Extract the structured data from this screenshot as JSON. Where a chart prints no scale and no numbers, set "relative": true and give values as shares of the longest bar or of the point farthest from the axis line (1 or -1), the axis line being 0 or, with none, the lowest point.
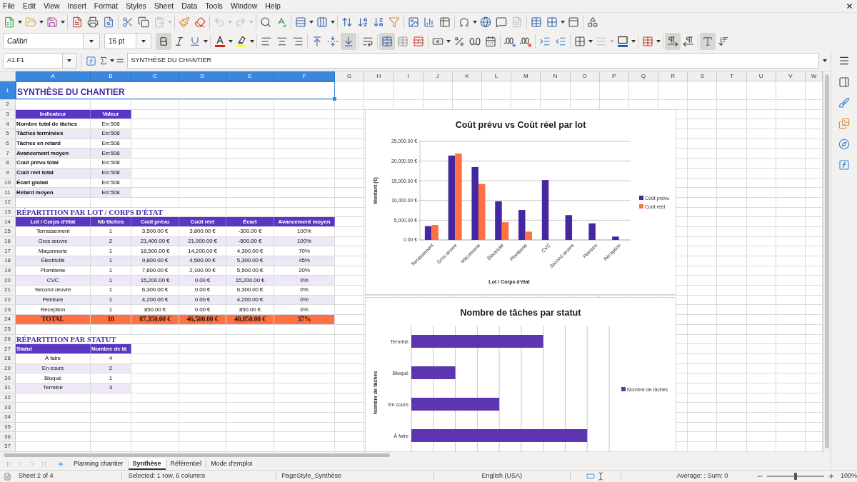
{
  "menu_bar": {
    "items": [
      "File",
      "Edit",
      "View",
      "Insert",
      "Format",
      "Styles",
      "Sheet",
      "Data",
      "Tools",
      "Window",
      "Help"
    ]
  },
  "standard_toolbar": {
    "groups": [
      [
        {
          "kind": "new",
          "dropdown": true,
          "disabled": false
        },
        {
          "kind": "open",
          "dropdown": true,
          "disabled": false
        },
        {
          "kind": "save",
          "dropdown": true,
          "disabled": false
        }
      ],
      [
        {
          "kind": "export_pdf",
          "dropdown": false,
          "disabled": false
        },
        {
          "kind": "print",
          "dropdown": false,
          "disabled": false
        },
        {
          "kind": "print_preview",
          "dropdown": false,
          "disabled": false
        }
      ],
      [
        {
          "kind": "cut",
          "dropdown": false,
          "disabled": false
        },
        {
          "kind": "copy",
          "dropdown": false,
          "disabled": false
        },
        {
          "kind": "paste",
          "dropdown": true,
          "disabled": true
        }
      ],
      [
        {
          "kind": "clone_formatting",
          "dropdown": false,
          "disabled": false
        },
        {
          "kind": "clear_formatting",
          "dropdown": false,
          "disabled": false
        }
      ],
      [
        {
          "kind": "undo",
          "dropdown": true,
          "disabled": true
        },
        {
          "kind": "redo",
          "dropdown": true,
          "disabled": true
        }
      ],
      [
        {
          "kind": "find_replace",
          "dropdown": false,
          "disabled": false
        },
        {
          "kind": "spelling",
          "dropdown": false,
          "disabled": false
        }
      ],
      [
        {
          "kind": "row",
          "dropdown": true,
          "disabled": false
        },
        {
          "kind": "column",
          "dropdown": true,
          "disabled": false
        }
      ],
      [
        {
          "kind": "sort",
          "dropdown": false,
          "disabled": false
        },
        {
          "kind": "sort_ascending",
          "dropdown": false,
          "disabled": false
        },
        {
          "kind": "sort_descending",
          "dropdown": false,
          "disabled": false
        },
        {
          "kind": "autofilter",
          "dropdown": false,
          "disabled": false
        }
      ],
      [
        {
          "kind": "image",
          "dropdown": false,
          "disabled": false
        },
        {
          "kind": "chart",
          "dropdown": false,
          "disabled": false
        },
        {
          "kind": "pivot_table",
          "dropdown": false,
          "disabled": false
        }
      ],
      [
        {
          "kind": "special_character",
          "dropdown": true,
          "disabled": false
        },
        {
          "kind": "hyperlink",
          "dropdown": false,
          "disabled": false
        },
        {
          "kind": "comment",
          "dropdown": false,
          "disabled": false
        },
        {
          "kind": "header_footer",
          "dropdown": false,
          "disabled": true
        }
      ],
      [
        {
          "kind": "print_area",
          "dropdown": false,
          "disabled": false
        },
        {
          "kind": "freeze",
          "dropdown": true,
          "disabled": false
        },
        {
          "kind": "split_window",
          "dropdown": false,
          "disabled": false
        }
      ],
      [
        {
          "kind": "shapes",
          "dropdown": false,
          "disabled": false
        }
      ]
    ]
  },
  "formatting_toolbar": {
    "font_name": "Calibri",
    "font_size": "16 pt",
    "groups": [
      [
        {
          "kind": "bold",
          "on": true,
          "dropdown": false,
          "disabled": false
        },
        {
          "kind": "italic",
          "on": false,
          "dropdown": false,
          "disabled": false
        },
        {
          "kind": "underline",
          "on": false,
          "dropdown": true,
          "disabled": false
        }
      ],
      [
        {
          "kind": "font_color",
          "on": false,
          "dropdown": true,
          "disabled": false
        },
        {
          "kind": "highlight",
          "on": false,
          "dropdown": true,
          "disabled": false
        }
      ],
      [
        {
          "kind": "align_left",
          "on": false,
          "dropdown": false,
          "disabled": false
        },
        {
          "kind": "align_center",
          "on": false,
          "dropdown": false,
          "disabled": false
        },
        {
          "kind": "align_right",
          "on": false,
          "dropdown": false,
          "disabled": false
        }
      ],
      [
        {
          "kind": "align_top",
          "on": false,
          "dropdown": false,
          "disabled": false
        },
        {
          "kind": "align_middle",
          "on": false,
          "dropdown": false,
          "disabled": false
        },
        {
          "kind": "align_bottom",
          "on": true,
          "dropdown": false,
          "disabled": false
        }
      ],
      [
        {
          "kind": "wrap_text",
          "on": false,
          "dropdown": false,
          "disabled": false
        }
      ],
      [
        {
          "kind": "merge_center",
          "on": true,
          "dropdown": false,
          "disabled": false
        },
        {
          "kind": "merge",
          "on": false,
          "dropdown": false,
          "disabled": false
        },
        {
          "kind": "unmerge",
          "on": false,
          "dropdown": false,
          "disabled": false
        }
      ],
      [
        {
          "kind": "currency",
          "on": false,
          "dropdown": true,
          "disabled": false
        },
        {
          "kind": "percent",
          "on": false,
          "dropdown": false,
          "disabled": false
        },
        {
          "kind": "number",
          "on": false,
          "dropdown": false,
          "disabled": false
        },
        {
          "kind": "date",
          "on": false,
          "dropdown": false,
          "disabled": false
        }
      ],
      [
        {
          "kind": "add_decimal",
          "on": false,
          "dropdown": false,
          "disabled": false
        },
        {
          "kind": "delete_decimal",
          "on": false,
          "dropdown": false,
          "disabled": false
        }
      ],
      [
        {
          "kind": "indent_increase",
          "on": false,
          "dropdown": false,
          "disabled": false
        },
        {
          "kind": "indent_decrease",
          "on": false,
          "dropdown": false,
          "disabled": false
        }
      ],
      [
        {
          "kind": "borders",
          "on": false,
          "dropdown": true,
          "disabled": false
        },
        {
          "kind": "border_style",
          "on": false,
          "dropdown": true,
          "disabled": true
        },
        {
          "kind": "border_color",
          "on": false,
          "dropdown": true,
          "disabled": false
        }
      ],
      [
        {
          "kind": "conditional",
          "on": false,
          "dropdown": true,
          "disabled": false
        }
      ],
      [
        {
          "kind": "ltr",
          "on": true,
          "dropdown": false,
          "disabled": false
        },
        {
          "kind": "rtl",
          "on": false,
          "dropdown": false,
          "disabled": false
        }
      ],
      [
        {
          "kind": "text_direction",
          "on": true,
          "dropdown": false,
          "disabled": false
        },
        {
          "kind": "vertical_text",
          "on": false,
          "dropdown": false,
          "disabled": false
        }
      ]
    ]
  },
  "formula_bar": {
    "name_box": "A1:F1",
    "content": "SYNTHÈSE DU CHANTIER"
  },
  "sheet": {
    "columns": [
      {
        "label": "A",
        "selected": true
      },
      {
        "label": "B",
        "selected": true
      },
      {
        "label": "C",
        "selected": true
      },
      {
        "label": "D",
        "selected": true
      },
      {
        "label": "E",
        "selected": true
      },
      {
        "label": "F",
        "selected": true
      },
      {
        "label": "G",
        "selected": false
      },
      {
        "label": "H",
        "selected": false
      },
      {
        "label": "I",
        "selected": false
      },
      {
        "label": "J",
        "selected": false
      },
      {
        "label": "K",
        "selected": false
      },
      {
        "label": "L",
        "selected": false
      },
      {
        "label": "M",
        "selected": false
      },
      {
        "label": "N",
        "selected": false
      },
      {
        "label": "O",
        "selected": false
      },
      {
        "label": "P",
        "selected": false
      },
      {
        "label": "Q",
        "selected": false
      },
      {
        "label": "R",
        "selected": false
      },
      {
        "label": "S",
        "selected": false
      },
      {
        "label": "T",
        "selected": false
      },
      {
        "label": "U",
        "selected": false
      },
      {
        "label": "V",
        "selected": false
      },
      {
        "label": "W",
        "selected": false
      }
    ],
    "rows": [
      {
        "label": "1",
        "selected": true,
        "kind": "title",
        "cells": [
          "SYNTHÈSE DU CHANTIER"
        ]
      },
      {
        "label": "2",
        "selected": false,
        "kind": "empty"
      },
      {
        "label": "3",
        "selected": false,
        "kind": "kpi_header",
        "cells": [
          "Indicateur",
          "Valeur"
        ]
      },
      {
        "label": "4",
        "selected": false,
        "kind": "kpi",
        "shaded": false,
        "cells": [
          "Nombre total de tâches",
          "Err:508"
        ]
      },
      {
        "label": "5",
        "selected": false,
        "kind": "kpi",
        "shaded": true,
        "cells": [
          "Tâches terminées",
          "Err:508"
        ]
      },
      {
        "label": "6",
        "selected": false,
        "kind": "kpi",
        "shaded": false,
        "cells": [
          "Tâches en retard",
          "Err:508"
        ]
      },
      {
        "label": "7",
        "selected": false,
        "kind": "kpi",
        "shaded": true,
        "cells": [
          "Avancement moyen",
          "Err:508"
        ]
      },
      {
        "label": "8",
        "selected": false,
        "kind": "kpi",
        "shaded": false,
        "cells": [
          "Coût prévu total",
          "Err:508"
        ]
      },
      {
        "label": "9",
        "selected": false,
        "kind": "kpi",
        "shaded": true,
        "cells": [
          "Coût réel total",
          "Err:508"
        ]
      },
      {
        "label": "10",
        "selected": false,
        "kind": "kpi",
        "shaded": false,
        "cells": [
          "Écart global",
          "Err:508"
        ]
      },
      {
        "label": "11",
        "selected": false,
        "kind": "kpi",
        "shaded": true,
        "cells": [
          "Retard moyen",
          "Err:508"
        ]
      },
      {
        "label": "12",
        "selected": false,
        "kind": "empty"
      },
      {
        "label": "13",
        "selected": false,
        "kind": "section_title",
        "cells": [
          "RÉPARTITION PAR LOT / CORPS D'ÉTAT"
        ]
      },
      {
        "label": "14",
        "selected": false,
        "kind": "lot_header",
        "cells": [
          "Lot / Corps d'état",
          "Nb tâches",
          "Coût prévu",
          "Coût réel",
          "Écart",
          "Avancement moyen"
        ]
      },
      {
        "label": "15",
        "selected": false,
        "kind": "lot",
        "shaded": false,
        "cells": [
          "Terrassement",
          "1",
          "3,500.00 €",
          "3,800.00 €",
          "-300.00 €",
          "100%"
        ]
      },
      {
        "label": "16",
        "selected": false,
        "kind": "lot",
        "shaded": true,
        "cells": [
          "Gros œuvre",
          "2",
          "21,400.00 €",
          "21,900.00 €",
          "-500.00 €",
          "100%"
        ]
      },
      {
        "label": "17",
        "selected": false,
        "kind": "lot",
        "shaded": false,
        "cells": [
          "Maçonnerie",
          "1",
          "18,500.00 €",
          "14,200.00 €",
          "4,300.00 €",
          "70%"
        ]
      },
      {
        "label": "18",
        "selected": false,
        "kind": "lot",
        "shaded": true,
        "cells": [
          "Électricité",
          "1",
          "9,800.00 €",
          "4,500.00 €",
          "5,300.00 €",
          "45%"
        ]
      },
      {
        "label": "19",
        "selected": false,
        "kind": "lot",
        "shaded": false,
        "cells": [
          "Plomberie",
          "1",
          "7,600.00 €",
          "2,100.00 €",
          "5,500.00 €",
          "20%"
        ]
      },
      {
        "label": "20",
        "selected": false,
        "kind": "lot",
        "shaded": true,
        "cells": [
          "CVC",
          "1",
          "15,200.00 €",
          "0.00 €",
          "15,200.00 €",
          "0%"
        ]
      },
      {
        "label": "21",
        "selected": false,
        "kind": "lot",
        "shaded": false,
        "cells": [
          "Second œuvre",
          "1",
          "6,300.00 €",
          "0.00 €",
          "6,300.00 €",
          "0%"
        ]
      },
      {
        "label": "22",
        "selected": false,
        "kind": "lot",
        "shaded": true,
        "cells": [
          "Peinture",
          "1",
          "4,200.00 €",
          "0.00 €",
          "4,200.00 €",
          "0%"
        ]
      },
      {
        "label": "23",
        "selected": false,
        "kind": "lot",
        "shaded": false,
        "cells": [
          "Réception",
          "1",
          "850.00 €",
          "0.00 €",
          "850.00 €",
          "0%"
        ]
      },
      {
        "label": "24",
        "selected": false,
        "kind": "total",
        "cells": [
          "TOTAL",
          "10",
          "87,350.00 €",
          "46,500.00 €",
          "40,850.00 €",
          "37%"
        ]
      },
      {
        "label": "25",
        "selected": false,
        "kind": "empty"
      },
      {
        "label": "26",
        "selected": false,
        "kind": "section_title",
        "cells": [
          "RÉPARTITION PAR STATUT"
        ]
      },
      {
        "label": "27",
        "selected": false,
        "kind": "status_header",
        "cells": [
          "Statut",
          "Nombre de tâ"
        ]
      },
      {
        "label": "28",
        "selected": false,
        "kind": "status",
        "shaded": false,
        "cells": [
          "À faire",
          "4"
        ]
      },
      {
        "label": "29",
        "selected": false,
        "kind": "status",
        "shaded": true,
        "cells": [
          "En cours",
          "2"
        ]
      },
      {
        "label": "30",
        "selected": false,
        "kind": "status",
        "shaded": false,
        "cells": [
          "Bloqué",
          "1"
        ]
      },
      {
        "label": "31",
        "selected": false,
        "kind": "status",
        "shaded": true,
        "cells": [
          "Terminé",
          "3"
        ]
      },
      {
        "label": "32",
        "selected": false,
        "kind": "empty"
      },
      {
        "label": "33",
        "selected": false,
        "kind": "empty"
      },
      {
        "label": "34",
        "selected": false,
        "kind": "empty"
      },
      {
        "label": "35",
        "selected": false,
        "kind": "empty"
      },
      {
        "label": "36",
        "selected": false,
        "kind": "empty"
      },
      {
        "label": "37",
        "selected": false,
        "kind": "empty"
      }
    ],
    "charts": [
      {
        "chart_data": {
          "type": "bar",
          "title": "Coût prévu vs Coût réel par lot",
          "xlabel": "Lot / Corps d'état",
          "ylabel": "Montant (€)",
          "categories": [
            "Terrassement",
            "Gros œuvre",
            "Maçonnerie",
            "Électricité",
            "Plomberie",
            "CVC",
            "Second œuvre",
            "Peinture",
            "Réception"
          ],
          "series": [
            {
              "name": "Coût prévu",
              "color": "#4527a0",
              "values": [
                3500,
                21400,
                18500,
                9800,
                7600,
                15200,
                6300,
                4200,
                850
              ]
            },
            {
              "name": "Coût réel",
              "color": "#ff7043",
              "values": [
                3800,
                21900,
                14200,
                4500,
                2100,
                0,
                0,
                0,
                0
              ]
            }
          ],
          "ylim": [
            0,
            25000
          ],
          "yticks": [
            {
              "value": 0,
              "label": "0.00 €"
            },
            {
              "value": 5000,
              "label": "5,000.00 €"
            },
            {
              "value": 10000,
              "label": "10,000.00 €"
            },
            {
              "value": 15000,
              "label": "15,000.00 €"
            },
            {
              "value": 20000,
              "label": "20,000.00 €"
            },
            {
              "value": 25000,
              "label": "25,000.00 €"
            }
          ],
          "grid": true,
          "legend": "right"
        }
      },
      {
        "chart_data": {
          "type": "bar",
          "orientation": "horizontal",
          "title": "Nombre de tâches par statut",
          "ylabel": "Nombre de tâches",
          "categories": [
            "Terminé",
            "Bloqué",
            "En cours",
            "À faire"
          ],
          "series": [
            {
              "name": "Nombre de tâches",
              "color": "#5e35b1",
              "values": [
                0.75,
                0.25,
                0.5,
                1
              ]
            }
          ],
          "relative": true,
          "grid": true,
          "legend": "right"
        }
      }
    ]
  },
  "sheet_tabs": [
    {
      "label": "Planning chantier",
      "selected": false
    },
    {
      "label": "Synthèse",
      "selected": true
    },
    {
      "label": "Référentiel",
      "selected": false
    },
    {
      "label": "Mode d'emploi",
      "selected": false
    }
  ],
  "status_bar": {
    "sheet_position": "Sheet 2 of 4",
    "selection": "Selected: 1 row, 6 columns",
    "page_style": "PageStyle_Synthèse",
    "language": "English (USA)",
    "summary": "Average: ; Sum: 0",
    "zoom": {
      "level": 0.5,
      "reading": "100%"
    }
  }
}
